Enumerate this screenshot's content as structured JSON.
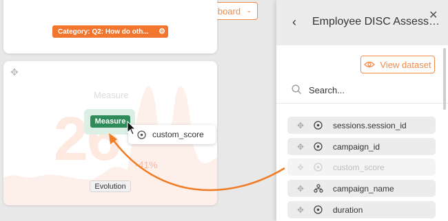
{
  "header": {
    "dashboard_label": "Dashboard"
  },
  "top_card": {
    "category_label": "Category: Q2: How do oth..."
  },
  "main_card": {
    "title": "Measure",
    "big_value": "26",
    "change": "-41%",
    "measure_chip": "Measure",
    "dragged_field": "custom_score",
    "evolution_label": "Evolution"
  },
  "panel": {
    "title": "Employee DISC Assessm...",
    "view_dataset": "View dataset",
    "search_placeholder": "Search...",
    "fields": [
      {
        "name": "sessions.session_id",
        "type": "measure-icon"
      },
      {
        "name": "campaign_id",
        "type": "measure-icon"
      },
      {
        "name": "custom_score",
        "type": "measure-icon"
      },
      {
        "name": "campaign_name",
        "type": "dimension-icon"
      },
      {
        "name": "duration",
        "type": "measure-icon"
      }
    ]
  },
  "colors": {
    "accent": "#f08a4b",
    "measure_green": "#2e8b5a",
    "arrow": "#f07c26"
  }
}
